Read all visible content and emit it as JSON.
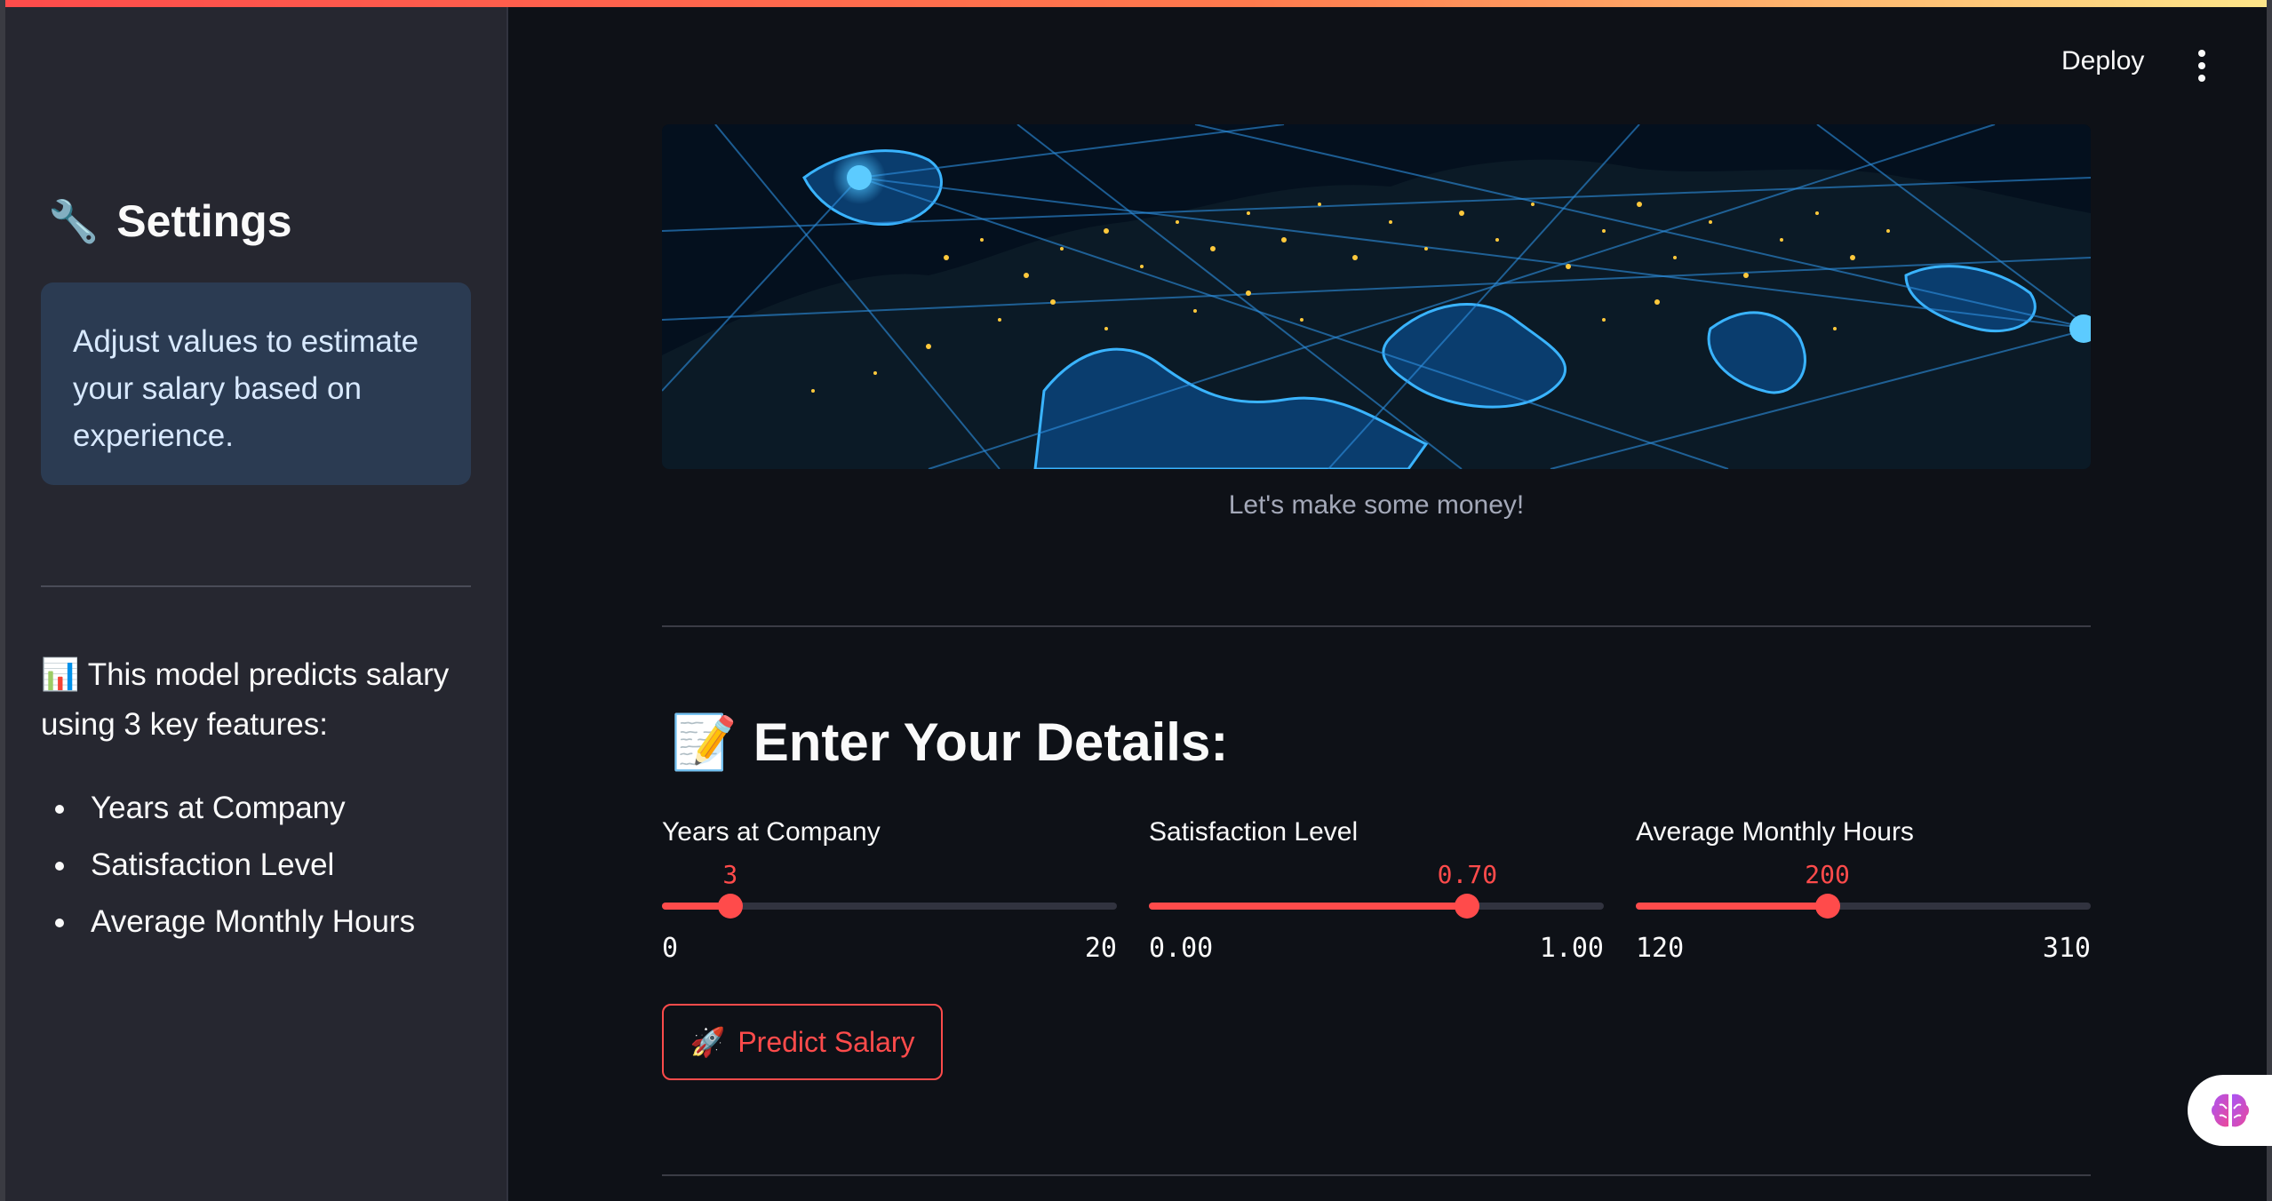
{
  "sidebar": {
    "title": "Settings",
    "title_icon": "wrench-icon",
    "info": "Adjust values to estimate your salary based on experience.",
    "description": "This model predicts salary using 3 key features:",
    "description_icon": "bar-chart-icon",
    "features": [
      "Years at Company",
      "Satisfaction Level",
      "Average Monthly Hours"
    ]
  },
  "header": {
    "deploy_label": "Deploy",
    "menu_icon": "vertical-dots-icon"
  },
  "main": {
    "banner_caption": "Let's make some money!",
    "heading": "Enter Your Details:",
    "heading_icon": "memo-icon",
    "sliders": [
      {
        "label": "Years at Company",
        "value": "3",
        "min": "0",
        "max": "20",
        "fraction": 0.15
      },
      {
        "label": "Satisfaction Level",
        "value": "0.70",
        "min": "0.00",
        "max": "1.00",
        "fraction": 0.7
      },
      {
        "label": "Average Monthly Hours",
        "value": "200",
        "min": "120",
        "max": "310",
        "fraction": 0.421
      }
    ],
    "predict_label": "Predict Salary",
    "predict_icon": "rocket-icon"
  },
  "colors": {
    "accent": "#ff4b4b",
    "sidebar_bg": "#262730",
    "main_bg": "#0e1117",
    "info_bg": "#2b3b52"
  }
}
